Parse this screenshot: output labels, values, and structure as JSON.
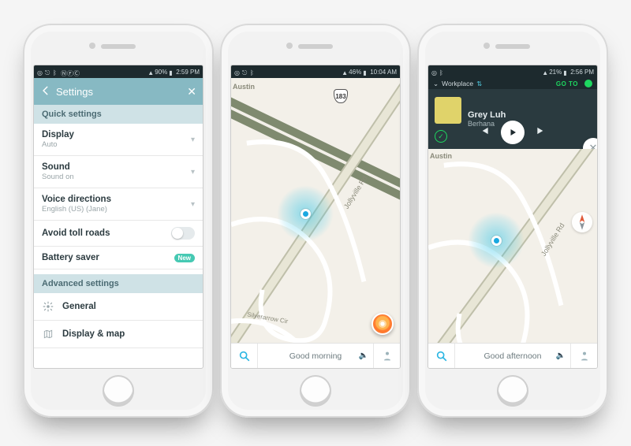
{
  "phone1": {
    "status": {
      "battery": "90%",
      "time": "2:59 PM"
    },
    "header": {
      "title": "Settings"
    },
    "sections": {
      "quick_label": "Quick settings",
      "advanced_label": "Advanced settings"
    },
    "rows": {
      "display": {
        "title": "Display",
        "sub": "Auto"
      },
      "sound": {
        "title": "Sound",
        "sub": "Sound on"
      },
      "voice": {
        "title": "Voice directions",
        "sub": "English (US) (Jane)"
      },
      "toll": {
        "title": "Avoid toll roads"
      },
      "battery": {
        "title": "Battery saver",
        "badge": "New"
      }
    },
    "advanced": {
      "general": "General",
      "displaymap": "Display & map"
    }
  },
  "phone2": {
    "status": {
      "battery": "46%",
      "time": "10:04 AM"
    },
    "map": {
      "city_label": "Austin",
      "road_label": "Jollyville Rd",
      "street_label": "Silverarrow Cir",
      "route_shield": "183"
    },
    "bottombar": {
      "greeting": "Good morning"
    }
  },
  "phone3": {
    "status": {
      "battery": "21%",
      "time": "2:56 PM"
    },
    "notice": {
      "label": "Workplace",
      "goto": "GO TO"
    },
    "player": {
      "track": "Grey Luh",
      "artist": "Berhana"
    },
    "map": {
      "city_label": "Austin",
      "road_label": "Jollyville Rd"
    },
    "bottombar": {
      "greeting": "Good afternoon"
    }
  }
}
